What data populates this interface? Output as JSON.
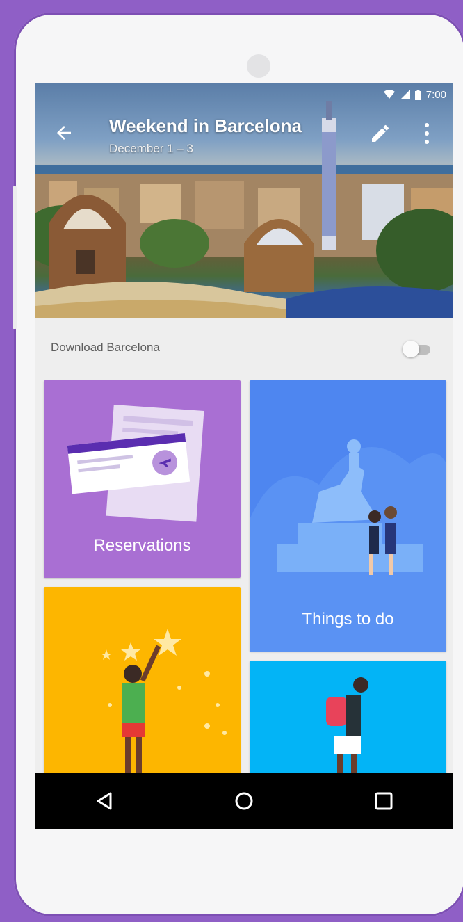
{
  "status_bar": {
    "time": "7:00"
  },
  "trip": {
    "title": "Weekend in Barcelona",
    "dates": "December 1 – 3"
  },
  "download": {
    "label": "Download Barcelona",
    "enabled": false
  },
  "cards": [
    {
      "label": "Reservations",
      "color": "#a96fd3"
    },
    {
      "label": "Things to do",
      "color": "#4e86f0"
    },
    {
      "label": "",
      "color": "#fdb600"
    },
    {
      "label": "",
      "color": "#03b4f6"
    }
  ],
  "icons": {
    "back": "arrow-left",
    "edit": "pencil",
    "more": "three-dots-vertical",
    "nav_back": "triangle-left",
    "nav_home": "circle",
    "nav_recents": "square"
  },
  "colors": {
    "device_background": "#8f5fc6",
    "screen_background": "#eeeeee"
  }
}
